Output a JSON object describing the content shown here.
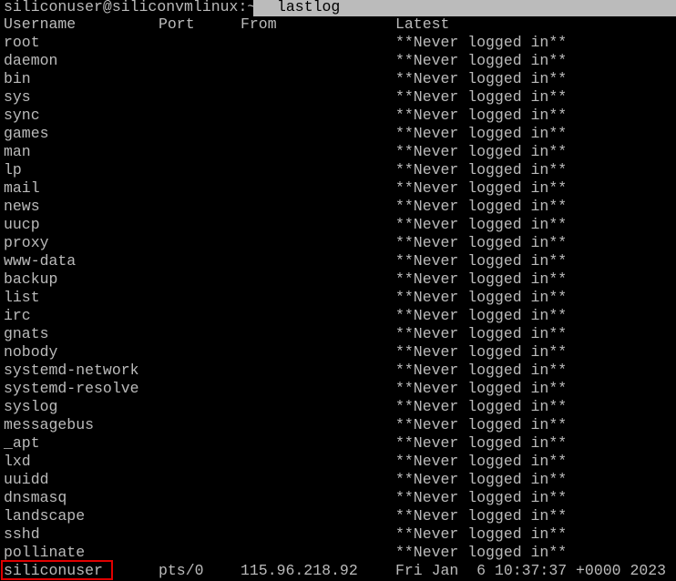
{
  "terminal": {
    "prompt": "siliconuser@siliconvmlinux:~$ ",
    "command": "lastlog",
    "headers": {
      "username": "Username",
      "port": "Port",
      "from": "From",
      "latest": "Latest"
    },
    "rows": [
      {
        "username": "root",
        "port": "",
        "from": "",
        "latest": "**Never logged in**"
      },
      {
        "username": "daemon",
        "port": "",
        "from": "",
        "latest": "**Never logged in**"
      },
      {
        "username": "bin",
        "port": "",
        "from": "",
        "latest": "**Never logged in**"
      },
      {
        "username": "sys",
        "port": "",
        "from": "",
        "latest": "**Never logged in**"
      },
      {
        "username": "sync",
        "port": "",
        "from": "",
        "latest": "**Never logged in**"
      },
      {
        "username": "games",
        "port": "",
        "from": "",
        "latest": "**Never logged in**"
      },
      {
        "username": "man",
        "port": "",
        "from": "",
        "latest": "**Never logged in**"
      },
      {
        "username": "lp",
        "port": "",
        "from": "",
        "latest": "**Never logged in**"
      },
      {
        "username": "mail",
        "port": "",
        "from": "",
        "latest": "**Never logged in**"
      },
      {
        "username": "news",
        "port": "",
        "from": "",
        "latest": "**Never logged in**"
      },
      {
        "username": "uucp",
        "port": "",
        "from": "",
        "latest": "**Never logged in**"
      },
      {
        "username": "proxy",
        "port": "",
        "from": "",
        "latest": "**Never logged in**"
      },
      {
        "username": "www-data",
        "port": "",
        "from": "",
        "latest": "**Never logged in**"
      },
      {
        "username": "backup",
        "port": "",
        "from": "",
        "latest": "**Never logged in**"
      },
      {
        "username": "list",
        "port": "",
        "from": "",
        "latest": "**Never logged in**"
      },
      {
        "username": "irc",
        "port": "",
        "from": "",
        "latest": "**Never logged in**"
      },
      {
        "username": "gnats",
        "port": "",
        "from": "",
        "latest": "**Never logged in**"
      },
      {
        "username": "nobody",
        "port": "",
        "from": "",
        "latest": "**Never logged in**"
      },
      {
        "username": "systemd-network",
        "port": "",
        "from": "",
        "latest": "**Never logged in**"
      },
      {
        "username": "systemd-resolve",
        "port": "",
        "from": "",
        "latest": "**Never logged in**"
      },
      {
        "username": "syslog",
        "port": "",
        "from": "",
        "latest": "**Never logged in**"
      },
      {
        "username": "messagebus",
        "port": "",
        "from": "",
        "latest": "**Never logged in**"
      },
      {
        "username": "_apt",
        "port": "",
        "from": "",
        "latest": "**Never logged in**"
      },
      {
        "username": "lxd",
        "port": "",
        "from": "",
        "latest": "**Never logged in**"
      },
      {
        "username": "uuidd",
        "port": "",
        "from": "",
        "latest": "**Never logged in**"
      },
      {
        "username": "dnsmasq",
        "port": "",
        "from": "",
        "latest": "**Never logged in**"
      },
      {
        "username": "landscape",
        "port": "",
        "from": "",
        "latest": "**Never logged in**"
      },
      {
        "username": "sshd",
        "port": "",
        "from": "",
        "latest": "**Never logged in**"
      },
      {
        "username": "pollinate",
        "port": "",
        "from": "",
        "latest": "**Never logged in**"
      },
      {
        "username": "siliconuser",
        "port": "pts/0",
        "from": "115.96.218.92",
        "latest": "Fri Jan  6 10:37:37 +0000 2023",
        "highlighted": true
      }
    ],
    "colors": {
      "text": "#bbbbbb",
      "background": "#000000",
      "selection": "#bbbbbb",
      "highlight_box": "#e00000"
    }
  }
}
